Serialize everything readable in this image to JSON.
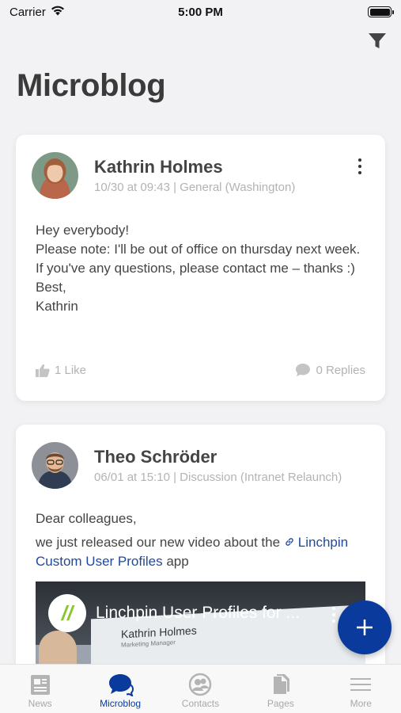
{
  "status_bar": {
    "carrier": "Carrier",
    "time": "5:00 PM"
  },
  "header": {
    "title": "Microblog"
  },
  "posts": [
    {
      "author": "Kathrin Holmes",
      "meta": "10/30 at 09:43 | General (Washington)",
      "body_lines": [
        "Hey everybody!",
        "Please note: I'll be out of office on thursday next week. If you've any questions, please contact me – thanks :)",
        "Best,",
        "Kathrin"
      ],
      "likes": "1 Like",
      "replies": "0 Replies"
    },
    {
      "author": "Theo Schröder",
      "meta": "06/01 at 15:10 | Discussion (Intranet Relaunch)",
      "greeting": "Dear colleagues,",
      "text_before_link": "we just released our new video about the ",
      "link_text": "Linchpin Custom User Profiles",
      "text_after_link": " app",
      "video": {
        "title": "Linchpin User Profiles for ...",
        "doc_name": "Kathrin Holmes",
        "doc_sub": "Marketing Manager"
      }
    }
  ],
  "tabs": [
    {
      "label": "News",
      "icon": "news-icon"
    },
    {
      "label": "Microblog",
      "icon": "microblog-icon"
    },
    {
      "label": "Contacts",
      "icon": "contacts-icon"
    },
    {
      "label": "Pages",
      "icon": "pages-icon"
    },
    {
      "label": "More",
      "icon": "more-menu-icon"
    }
  ],
  "active_tab": "Microblog",
  "colors": {
    "accent": "#0a3a9c",
    "link": "#1f4aa0",
    "muted": "#b3b3b3",
    "background": "#f2f2f4"
  }
}
